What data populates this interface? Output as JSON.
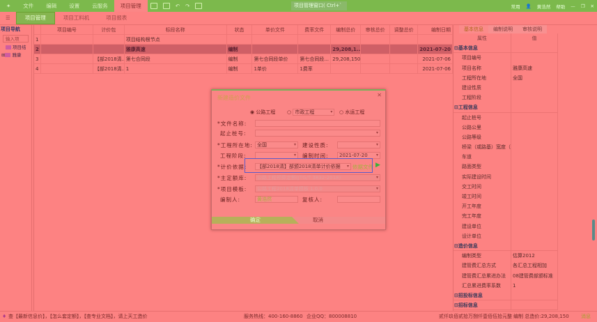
{
  "menubar": {
    "items": [
      "文件",
      "编辑",
      "设置",
      "云服务",
      "项目管理"
    ],
    "active": 4,
    "window_title": "项目管理窗口( Ctrl+`",
    "user": "黄浩然",
    "right_items": [
      "常用",
      "帮助"
    ]
  },
  "ribbon": {
    "tabs": [
      "项目管理",
      "项目工料机",
      "项目报表"
    ],
    "active": 0
  },
  "nav": {
    "title": "项目导航",
    "search_placeholder": "输入项",
    "items": [
      "项目结",
      "雅康"
    ]
  },
  "grid": {
    "columns": [
      "",
      "项目编号",
      "计价包",
      "标段名称",
      "状态",
      "单价文件",
      "费率文件",
      "编制总价",
      "审核总价",
      "调整总价",
      "编制日期"
    ],
    "rows": [
      [
        "1",
        "",
        "",
        "项目结构根节点",
        "",
        "",
        "",
        "",
        "",
        "",
        ""
      ],
      [
        "2",
        "",
        "",
        "雅康高速",
        "编制",
        "",
        "",
        "29,208,1...",
        "",
        "",
        "2021-07-20"
      ],
      [
        "3",
        "",
        "【部2018清...",
        "第七合同段",
        "编制",
        "第七合同段单价",
        "第七合同段...",
        "29,208,150",
        "",
        "",
        "2021-07-06"
      ],
      [
        "4",
        "",
        "【部2018清...",
        "1",
        "编制",
        "1单价",
        "1费率",
        "",
        "",
        "",
        "2021-07-06"
      ]
    ],
    "selected_row": 1
  },
  "props": {
    "tabs": [
      "基本信息",
      "编制说明",
      "审核说明"
    ],
    "active": 0,
    "head": [
      "属性",
      "值"
    ],
    "rows": [
      {
        "g": true,
        "k": "基本信息",
        "v": ""
      },
      {
        "k": "项目编号",
        "v": ""
      },
      {
        "k": "项目名称",
        "v": "雅康高速"
      },
      {
        "k": "工程所在地",
        "v": "全国"
      },
      {
        "k": "建设性质",
        "v": ""
      },
      {
        "k": "工程阶段",
        "v": ""
      },
      {
        "g": true,
        "k": "工程信息",
        "v": ""
      },
      {
        "k": "起止桩号",
        "v": ""
      },
      {
        "k": "公路公里",
        "v": ""
      },
      {
        "k": "公路等级",
        "v": ""
      },
      {
        "k": "桥梁（或路基）宽度（",
        "v": ""
      },
      {
        "k": "车道",
        "v": ""
      },
      {
        "k": "路面类型",
        "v": ""
      },
      {
        "k": "实际建设时间",
        "v": ""
      },
      {
        "k": "交工时间",
        "v": ""
      },
      {
        "k": "竣工时间",
        "v": ""
      },
      {
        "k": "开工年度",
        "v": ""
      },
      {
        "k": "完工年度",
        "v": ""
      },
      {
        "k": "建设单位",
        "v": ""
      },
      {
        "k": "设计单位",
        "v": ""
      },
      {
        "g": true,
        "k": "造价信息",
        "v": ""
      },
      {
        "k": "编制类型",
        "v": "估算2012"
      },
      {
        "k": "建管费汇总方式",
        "v": "各汇总工程相加"
      },
      {
        "k": "建管费汇总累进办法",
        "v": "08建管费部颁标准"
      },
      {
        "k": "汇总累进费率系数",
        "v": "1"
      },
      {
        "g": true,
        "k": "招投标信息",
        "v": ""
      },
      {
        "g": true,
        "k": "招标信息",
        "v": ""
      }
    ]
  },
  "dialog": {
    "title": "新建造价文件",
    "radios": [
      "公路工程",
      "市政工程",
      "水运工程"
    ],
    "file_name_label": "*文件名称:",
    "file_name": "",
    "stake_label": "起止桩号:",
    "stake": "",
    "location_label": "*工程所在地:",
    "location": "全国",
    "nature_label": "建设性质:",
    "nature": "",
    "stage_label": "工程阶段:",
    "stage": "",
    "date_label": "编制时间:",
    "date": "2021-07-20",
    "basis_label": "*计价依据:",
    "basis": "【部2018清】部颁2018清单计价依据",
    "basis_link": "依据文件",
    "quota_label": "*主定额库:",
    "quota": "公路工程预算定额(JTG/T 3832-2018)",
    "template_label": "*项目模板:",
    "template": "公路工程2018清单模板 1.0.0",
    "author_label": "编制人:",
    "author": "黄浩然",
    "reviewer_label": "复核人:",
    "reviewer": "",
    "ok": "确定",
    "cancel": "取消"
  },
  "status": {
    "left": "查【最新信息价】，【怎么套定额】，【查专业文档】，请上天工造价",
    "hotline": "服务热线：400-160-8860",
    "qq": "企业QQ：800008810",
    "total_words": "贰仟玖佰贰拾万捌仟壹佰伍拾元整",
    "total": "编制 总造价:29,208,150",
    "msg": "消息"
  }
}
